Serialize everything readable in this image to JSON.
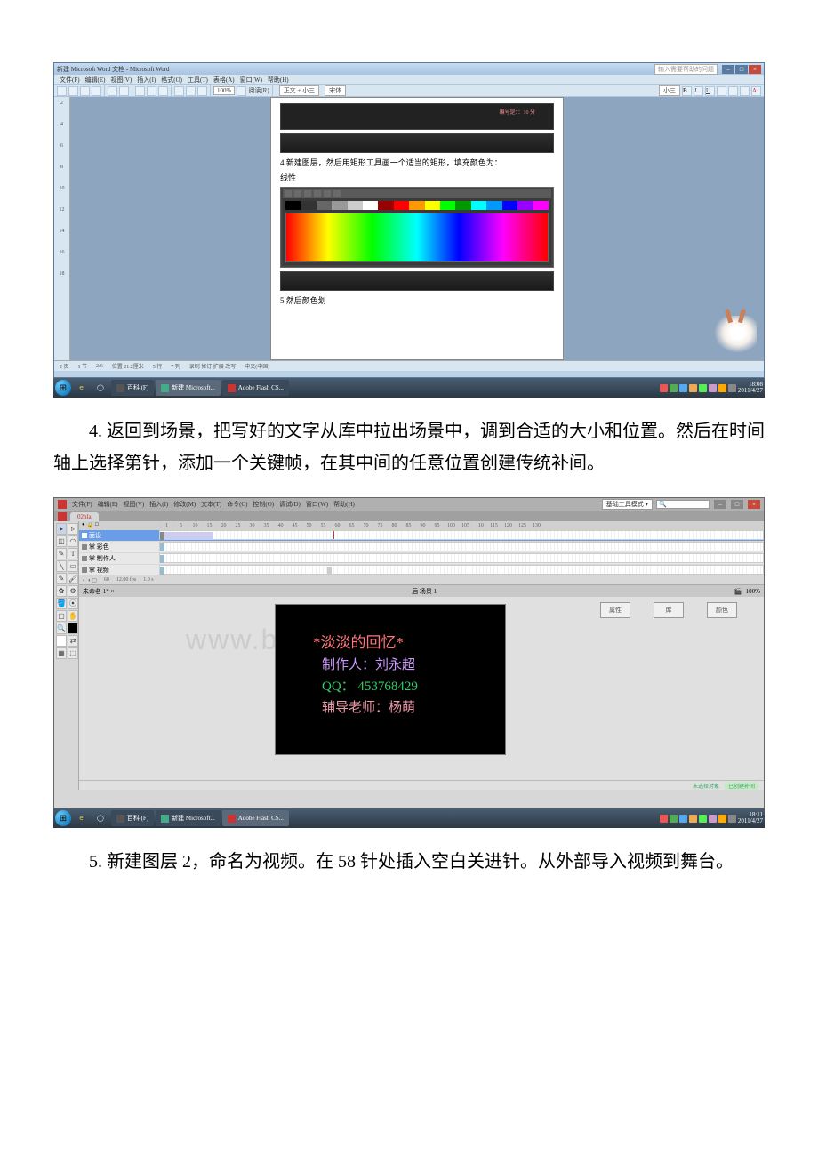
{
  "paragraphs": {
    "p4": "4. 返回到场景，把写好的文字从库中拉出场景中，调到合适的大小和位置。然后在时间轴上选择第针，添加一个关键帧，在其中间的任意位置创建传统补间。",
    "p5": "5. 新建图层 2，命名为视频。在 58 针处插入空白关进针。从外部导入视频到舞台。"
  },
  "word_screenshot": {
    "title": "新建 Microsoft Word 文档 - Microsoft Word",
    "help_placeholder": "输入需要帮助的问题",
    "menus": [
      "文件(F)",
      "编辑(E)",
      "视图(V)",
      "插入(I)",
      "格式(O)",
      "工具(T)",
      "表格(A)",
      "窗口(W)",
      "帮助(H)"
    ],
    "toolbar": {
      "zoom": "100%",
      "read_label": "阅读(R)",
      "style": "正文 + 小三",
      "font": "宋体",
      "size": "小三"
    },
    "ruler_left": [
      "2",
      "4",
      "6",
      "8",
      "10",
      "12",
      "14",
      "16",
      "18"
    ],
    "embedded_doc": {
      "line_top_pink": "编号是7：10 分",
      "caption_4": "4 新建图层，然后用矩形工具画一个适当的矩形，填充颜色为：",
      "linear_label": "线性",
      "caption_5": "5 然后颜色划"
    },
    "statusbar": {
      "page": "2 页",
      "section": "1 节",
      "pages": "2/6",
      "position": "位置 21.2厘米",
      "line": "5 行",
      "col": "7 列",
      "lang": "中文(中国)",
      "extra": "录制 修订 扩展 改写"
    },
    "taskbar": {
      "tray_label": "百科 (F)",
      "app1": "新建 Microsoft...",
      "app2": "Adobe Flash CS...",
      "clock_time": "18:08",
      "clock_date": "2011/4/27"
    }
  },
  "flash_screenshot": {
    "menus": [
      "文件(F)",
      "编辑(E)",
      "视图(V)",
      "插入(I)",
      "修改(M)",
      "文本(T)",
      "命令(C)",
      "控制(O)",
      "调试(D)",
      "窗口(W)",
      "帮助(H)"
    ],
    "top_right": {
      "combo": "基础工具模式 ▾",
      "search_icon": "🔍"
    },
    "doc_tab": "02hla",
    "frame_numbers": [
      1,
      5,
      10,
      15,
      20,
      25,
      30,
      35,
      40,
      45,
      50,
      55,
      60,
      65,
      70,
      75,
      80,
      85,
      90,
      95,
      100,
      105,
      110,
      115,
      120,
      125,
      130
    ],
    "layers": [
      {
        "name": "面设",
        "selected": true
      },
      {
        "name": "掌 彩色"
      },
      {
        "name": "掌 制作人"
      },
      {
        "name": "掌 视频"
      }
    ],
    "timeline_footer": {
      "frame": "60",
      "fps": "12.00 fps",
      "time": "1.0 s"
    },
    "scene_tab": "未命名 1*  ×",
    "scene_label": "后 场景 1",
    "zoom": "100%",
    "stage_text": {
      "l1": "*淡淡的回忆*",
      "l2": "制作人：刘永超",
      "l3": "QQ：  453768429",
      "l4": "辅导老师：杨萌"
    },
    "mini_panels": {
      "p1": "属性",
      "p2": "库",
      "p3": "颜色"
    },
    "status": {
      "left": "未选择对象",
      "right": "已创建补间"
    },
    "taskbar": {
      "tray_label": "百科 (F)",
      "app1": "新建 Microsoft...",
      "app2": "Adobe Flash CS...",
      "clock_time": "18:11",
      "clock_date": "2011/4/27"
    },
    "watermark": "www.bdocx.com"
  }
}
